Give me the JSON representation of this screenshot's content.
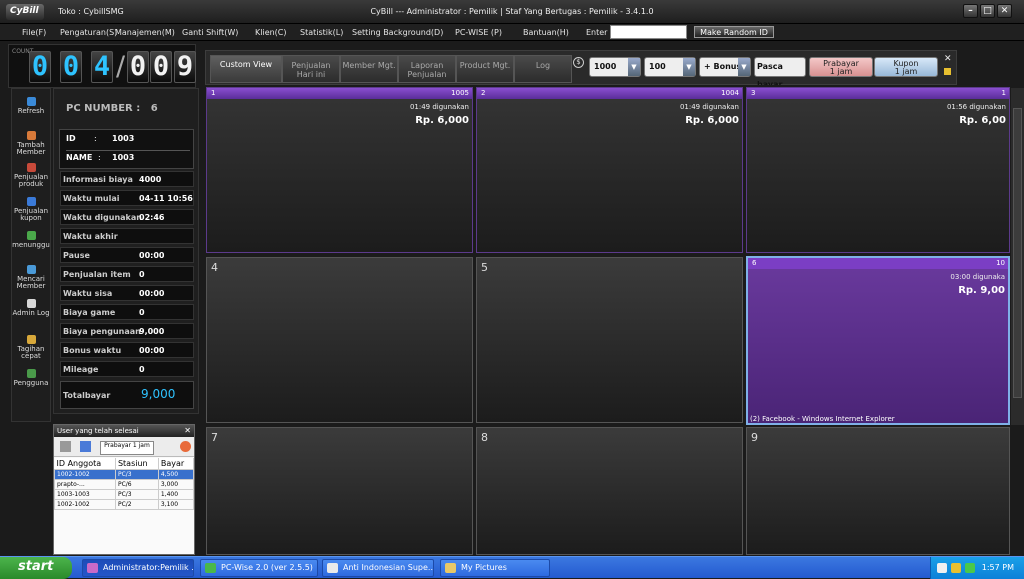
{
  "window": {
    "logo": "CyBill",
    "shop": "Toko : CybillSMG",
    "title": "CyBill --- Administrator : Pemilik | Staf Yang Bertugas : Pemilik - 3.4.1.0"
  },
  "menu": {
    "items": [
      "File(F)",
      "Pengaturan(S)",
      "Manajemen(M)",
      "Ganti Shift(W)",
      "Klien(C)",
      "Statistik(L)",
      "Setting Background(D)",
      "PC-WISE (P)",
      "Bantuan(H)",
      "Enter"
    ],
    "enter_value": "",
    "random_button": "Make Random ID"
  },
  "counter": {
    "label": "COUNT",
    "used": [
      "0",
      "0",
      "4"
    ],
    "total": [
      "0",
      "0",
      "9"
    ],
    "separator": "/"
  },
  "toolbar": {
    "tabs": [
      {
        "label": "Custom View",
        "active": true
      },
      {
        "label": "Penjualan Hari ini",
        "active": false
      },
      {
        "label": "Member Mgt.",
        "active": false
      },
      {
        "label": "Laporan Penjualan",
        "active": false
      },
      {
        "label": "Product Mgt.",
        "active": false
      },
      {
        "label": "Log",
        "active": false
      }
    ],
    "amount1": "1000",
    "amount2": "100",
    "bonus": "+ Bonus",
    "pasca": "Pasca bayar",
    "prabayar": "Prabayar",
    "prabayar_sub": "1 jam",
    "kupon": "Kupon",
    "kupon_sub": "1 jam"
  },
  "left_nav": [
    {
      "label": "Refresh",
      "icon": "refresh-icon",
      "color": "#3a8ad8"
    },
    {
      "label": "Tambah Member",
      "icon": "add-member-icon",
      "color": "#d87a3a"
    },
    {
      "label": "Penjualan produk",
      "icon": "product-icon",
      "color": "#c84a3a"
    },
    {
      "label": "Penjualan kupon",
      "icon": "coupon-icon",
      "color": "#3a7ad8"
    },
    {
      "label": "menunggu",
      "icon": "waiting-icon",
      "color": "#4aa84a"
    },
    {
      "label": "Mencari Member",
      "icon": "search-member-icon",
      "color": "#4a9ad8"
    },
    {
      "label": "Admin Log",
      "icon": "log-icon",
      "color": "#d8d8d8"
    },
    {
      "label": "Tagihan cepat",
      "icon": "bill-icon",
      "color": "#d8a83a"
    },
    {
      "label": "Pengguna",
      "icon": "users-icon",
      "color": "#4a9a4a"
    }
  ],
  "info": {
    "pc_label": "PC NUMBER :",
    "pc_number": "6",
    "id_label": "ID",
    "id_value": "1003",
    "name_label": "NAME",
    "name_value": "1003",
    "rows": [
      {
        "k": "Informasi biaya",
        "v": "4000"
      },
      {
        "k": "Waktu mulai",
        "v": "04-11 10:56"
      },
      {
        "k": "Waktu digunakan",
        "v": "02:46"
      },
      {
        "k": "Waktu akhir",
        "v": ""
      },
      {
        "k": "Pause",
        "v": "00:00"
      },
      {
        "k": "Penjualan item",
        "v": "0"
      },
      {
        "k": "Waktu sisa",
        "v": "00:00"
      },
      {
        "k": "Biaya game",
        "v": "0"
      },
      {
        "k": "Biaya pengunaan",
        "v": "9,000"
      },
      {
        "k": "Bonus waktu",
        "v": "00:00"
      },
      {
        "k": "Mileage",
        "v": "0"
      }
    ],
    "total_label": "Totalbayar",
    "total_value": "9,000"
  },
  "user_panel": {
    "title": "User yang telah selesai",
    "filter": "Prabayar 1 jam",
    "columns": [
      "ID Anggota",
      "Stasiun",
      "Bayar"
    ],
    "rows": [
      [
        "1002-1002",
        "PC/3",
        "4,500"
      ],
      [
        "prapto-...",
        "PC/6",
        "3,000"
      ],
      [
        "1003-1003",
        "PC/3",
        "1,400"
      ],
      [
        "1002-1002",
        "PC/2",
        "3,100"
      ]
    ]
  },
  "pcs": [
    {
      "num": "1",
      "active": true,
      "id": "1005",
      "used": "01:49 digunakan",
      "cost": "Rp. 6,000",
      "footer": ""
    },
    {
      "num": "2",
      "active": true,
      "id": "1004",
      "used": "01:49 digunakan",
      "cost": "Rp. 6,000",
      "footer": ""
    },
    {
      "num": "3",
      "active": true,
      "id": "1",
      "used": "01:56 digunakan",
      "cost": "Rp. 6,00",
      "footer": ""
    },
    {
      "num": "4",
      "active": false,
      "id": "",
      "used": "",
      "cost": "",
      "footer": ""
    },
    {
      "num": "5",
      "active": false,
      "id": "",
      "used": "",
      "cost": "",
      "footer": ""
    },
    {
      "num": "6",
      "active": true,
      "hot": true,
      "id": "10",
      "used": "03:00 digunaka",
      "cost": "Rp. 9,00",
      "footer": "(2) Facebook - Windows Internet Explorer"
    },
    {
      "num": "7",
      "active": false,
      "id": "",
      "used": "",
      "cost": "",
      "footer": ""
    },
    {
      "num": "8",
      "active": false,
      "id": "",
      "used": "",
      "cost": "",
      "footer": ""
    },
    {
      "num": "9",
      "active": false,
      "id": "",
      "used": "",
      "cost": "",
      "footer": ""
    }
  ],
  "taskbar": {
    "start": "start",
    "tasks": [
      "Administrator:Pemilik ...",
      "PC-Wise 2.0 (ver 2.5.5)",
      "Anti Indonesian Supe...",
      "My Pictures"
    ],
    "clock": "1:57 PM"
  }
}
